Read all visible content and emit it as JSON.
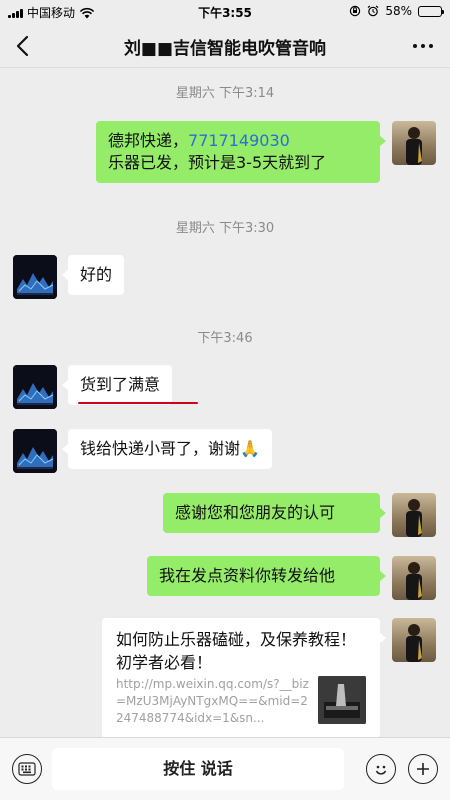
{
  "status_bar": {
    "carrier": "中国移动",
    "time": "下午3:55",
    "battery": "58%",
    "battery_level": 0.58
  },
  "nav": {
    "title": "刘■■吉信智能电吹管音响"
  },
  "messages": {
    "ts1": "星期六 下午3:14",
    "m1_line1_prefix": "德邦快递，",
    "m1_tracking": "7717149030",
    "m1_line2": "乐器已发，预计是3-5天就到了",
    "ts2": "星期六 下午3:30",
    "m2": "好的",
    "ts3": "下午3:46",
    "m3": "货到了满意",
    "m4": "钱给快递小哥了，谢谢🙏",
    "m5": "感谢您和您朋友的认可",
    "m6": "我在发点资料你转发给他",
    "card": {
      "title": "如何防止乐器磕碰，及保养教程！初学者必看！",
      "url": "http://mp.weixin.qq.com/s?__biz=MzU3MjAyNTgxMQ==&mid=2247488774&idx=1&sn..."
    }
  },
  "input_bar": {
    "voice_label": "按住 说话"
  },
  "colors": {
    "sent_bubble": "#95ec69",
    "received_bubble": "#ffffff",
    "background": "#ededed",
    "link": "#2a6fd6",
    "annotation_underline": "#d0021b"
  },
  "icons": [
    "back-chevron-icon",
    "more-dots-icon",
    "wifi-icon",
    "alarm-icon",
    "lock-rotation-icon",
    "keyboard-icon",
    "emoji-icon",
    "plus-icon"
  ]
}
